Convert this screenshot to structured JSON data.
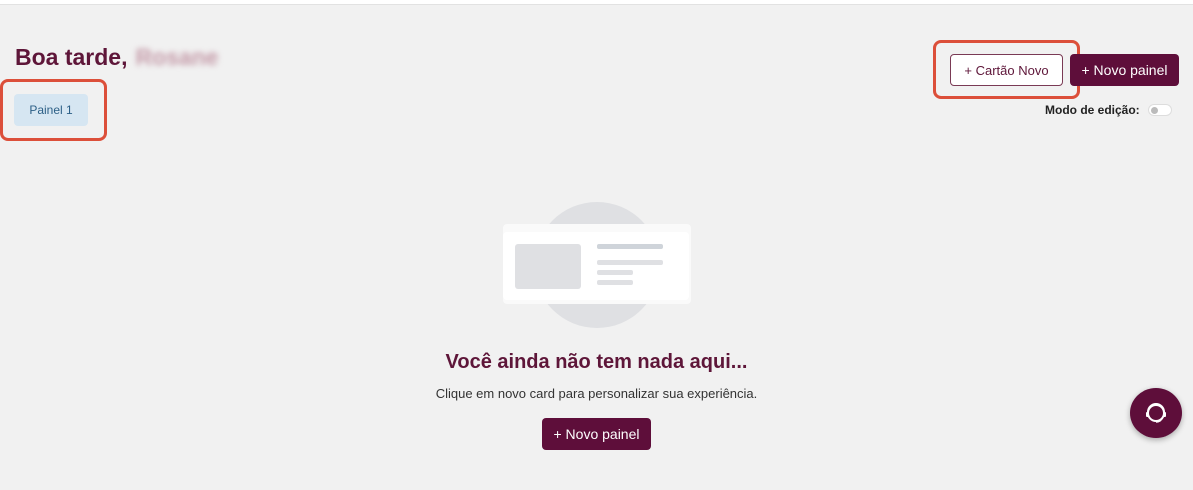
{
  "header": {
    "greeting": "Boa tarde,",
    "user_name": "Rosane"
  },
  "tabs": [
    {
      "label": "Painel 1",
      "active": true
    }
  ],
  "actions": {
    "new_card_label": "+ Cartão Novo",
    "new_panel_label": "+ Novo painel",
    "edit_mode_label": "Modo de edição:",
    "edit_mode_on": false
  },
  "empty_state": {
    "title": "Você ainda não tem nada aqui...",
    "subtitle": "Clique em novo card para personalizar sua experiência.",
    "button_label": "+ Novo painel"
  },
  "icons": {
    "fab": "chat-support-icon"
  },
  "colors": {
    "brand": "#5e0e3a",
    "highlight": "#dc4f3a",
    "tab_bg": "#d6e6f2"
  }
}
